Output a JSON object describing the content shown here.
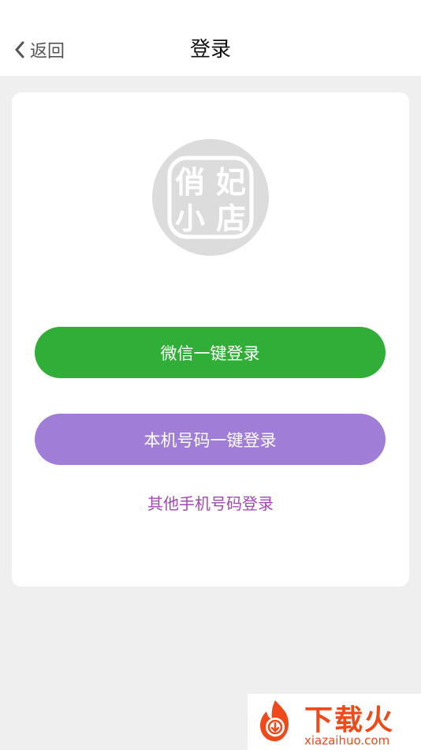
{
  "header": {
    "back_label": "返回",
    "title": "登录"
  },
  "logo": {
    "chars": [
      "俏",
      "妃",
      "小",
      "店"
    ]
  },
  "buttons": {
    "wechat_login": "微信一键登录",
    "phone_login": "本机号码一键登录",
    "other_phone_login": "其他手机号码登录"
  },
  "watermark": {
    "brand": "下载火",
    "domain": "xiazaihuo.com"
  },
  "colors": {
    "wechat_green": "#31ae38",
    "phone_purple": "#a07dd6",
    "link_purple": "#a348b3",
    "watermark_orange": "#ef4a1a",
    "page_background": "#efefef"
  },
  "icons": {
    "back": "chevron-left-icon",
    "watermark": "flame-logo-icon"
  }
}
